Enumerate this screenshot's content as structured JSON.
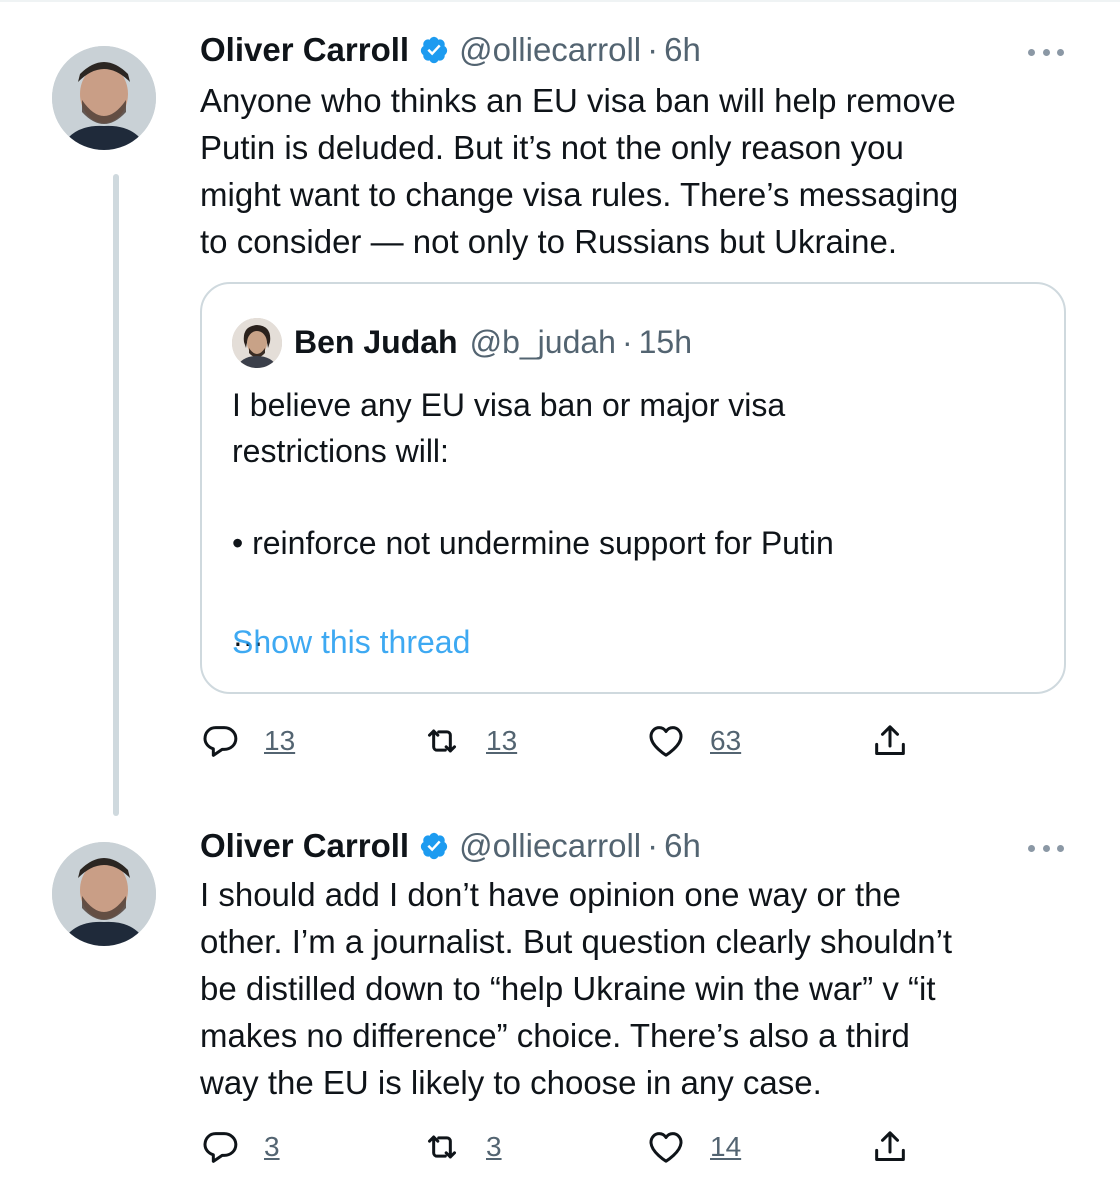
{
  "tweets": [
    {
      "name": "Oliver Carroll",
      "handle": "@olliecarroll",
      "separator": "·",
      "time": "6h",
      "text": "Anyone who thinks an EU visa ban will help remove\nPutin is deluded. But it’s not the only reason you\nmight want to change visa rules. There’s messaging\nto consider — not only to Russians but Ukraine.",
      "quote": {
        "name": "Ben Judah",
        "handle": "@b_judah",
        "separator": "·",
        "time": "15h",
        "text": "I believe any EU visa ban or major visa\nrestrictions will:\n\n• reinforce not undermine support for Putin\n\n…",
        "link": "Show this thread"
      },
      "actions": {
        "replies": "13",
        "retweets": "13",
        "likes": "63"
      }
    },
    {
      "name": "Oliver Carroll",
      "handle": "@olliecarroll",
      "separator": "·",
      "time": "6h",
      "text": "I should add I don’t have opinion one way or the\nother. I’m a journalist. But question clearly shouldn’t\nbe distilled down to “help Ukraine win the war” v “it\nmakes no difference” choice. There’s also a third\nway the EU is likely to choose in any case.",
      "actions": {
        "replies": "3",
        "retweets": "3",
        "likes": "14"
      }
    }
  ],
  "icons": {
    "verified": "verified-badge-icon",
    "reply": "reply-icon",
    "retweet": "retweet-icon",
    "like": "like-icon",
    "share": "share-icon",
    "more": "more-icon"
  },
  "colors": {
    "accent": "#1d9bf0",
    "secondary_text": "#536471",
    "border": "#cfd9de"
  }
}
